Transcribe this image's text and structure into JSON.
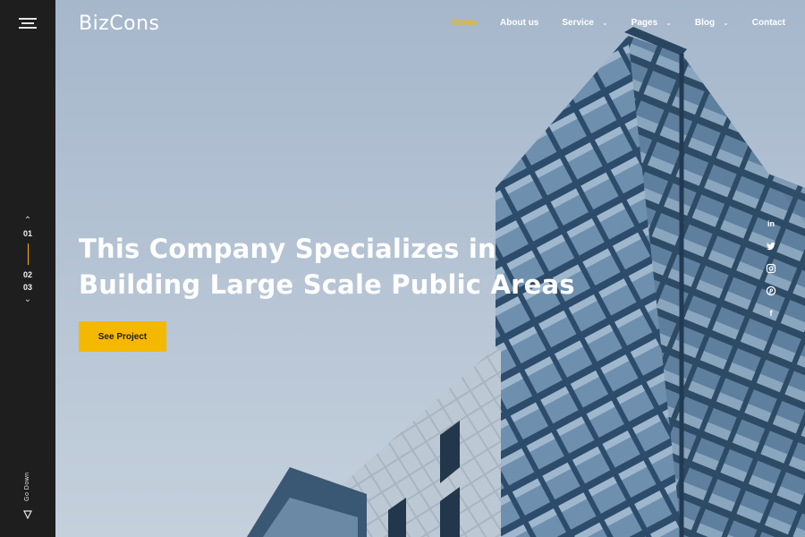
{
  "brand": {
    "name": "BizCons"
  },
  "nav": {
    "items": [
      {
        "label": "Home",
        "active": true,
        "dropdown": false
      },
      {
        "label": "About us",
        "active": false,
        "dropdown": false
      },
      {
        "label": "Service",
        "active": false,
        "dropdown": true
      },
      {
        "label": "Pages",
        "active": false,
        "dropdown": true
      },
      {
        "label": "Blog",
        "active": false,
        "dropdown": true
      },
      {
        "label": "Contact",
        "active": false,
        "dropdown": false
      }
    ]
  },
  "hero": {
    "headline": "This Company Specializes in Building Large Scale Public Areas",
    "cta_label": "See Project"
  },
  "slider": {
    "slides": [
      "01",
      "02",
      "03"
    ],
    "active_index": 0
  },
  "scroll": {
    "label": "Go Down"
  },
  "social": {
    "icons": [
      "linkedin-icon",
      "twitter-icon",
      "instagram-icon",
      "pinterest-icon",
      "facebook-icon"
    ]
  },
  "colors": {
    "accent": "#f5b800",
    "rail": "#1e1e1e",
    "text_light": "#ffffff"
  }
}
